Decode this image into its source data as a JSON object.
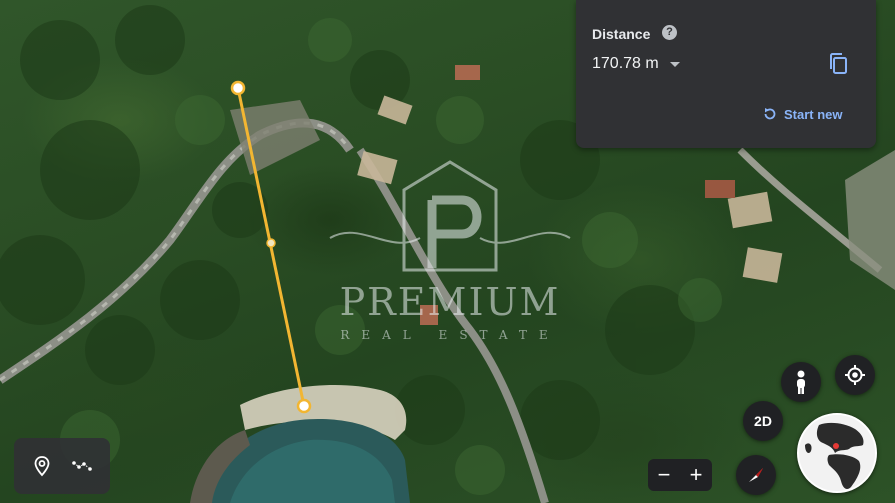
{
  "distance_panel": {
    "title": "Distance",
    "value": "170.78 m",
    "start_new_label": "Start new"
  },
  "watermark": {
    "brand": "PREMIUM",
    "tagline": "REAL ESTATE"
  },
  "controls": {
    "view_mode_label": "2D",
    "zoom_out_label": "−",
    "zoom_in_label": "+"
  },
  "colors": {
    "panel_bg": "#303134",
    "accent_link": "#8ab4f8",
    "measure_line": "#f2b632",
    "compass_red": "#e53935"
  },
  "icons": [
    "help-icon",
    "chevron-down-icon",
    "copy-icon",
    "refresh-icon",
    "place-pin-icon",
    "path-icon",
    "pegman-icon",
    "my-location-icon",
    "compass-icon",
    "globe-icon"
  ]
}
